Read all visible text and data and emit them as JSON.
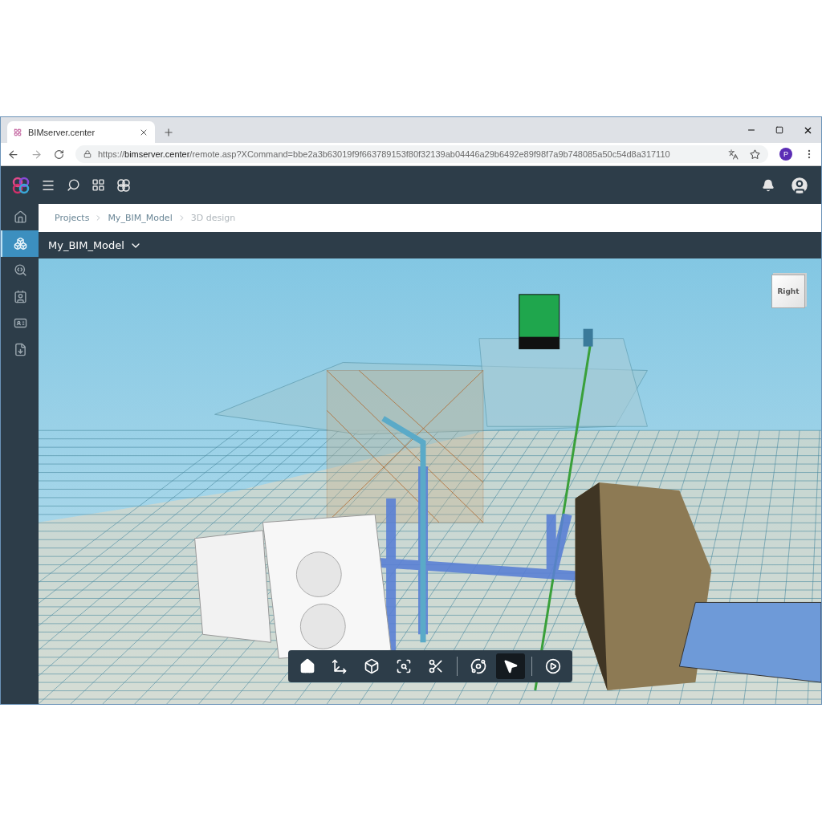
{
  "browser": {
    "tab_title": "BIMserver.center",
    "url": "https://**bimserver.center**/remote.asp?XCommand=bbe2a3b63019f9f663789153f80f32139ab04446a29b6492e89f98f7a9b748085a50c54d8a317110",
    "profile_initial": "P"
  },
  "sidebar": {
    "items": [
      {
        "kind": "home",
        "selected": false
      },
      {
        "kind": "model",
        "selected": true
      },
      {
        "kind": "inspect",
        "selected": false
      },
      {
        "kind": "contacts",
        "selected": false
      },
      {
        "kind": "certificate",
        "selected": false
      },
      {
        "kind": "download",
        "selected": false
      }
    ]
  },
  "breadcrumbs": [
    {
      "label": "Projects",
      "current": false
    },
    {
      "label": "My_BIM_Model",
      "current": false
    },
    {
      "label": "3D design",
      "current": true
    }
  ],
  "model_title": "My_BIM_Model",
  "view_cube": {
    "face": "Right"
  },
  "toolbar": {
    "groups": [
      {
        "tools": [
          {
            "kind": "home",
            "selected": false
          },
          {
            "kind": "axes",
            "selected": false
          },
          {
            "kind": "fit",
            "selected": false
          },
          {
            "kind": "zoom-window",
            "selected": false
          },
          {
            "kind": "section",
            "selected": false
          }
        ]
      },
      {
        "tools": [
          {
            "kind": "orbit",
            "selected": false
          },
          {
            "kind": "select",
            "selected": true
          }
        ]
      },
      {
        "tools": [
          {
            "kind": "play",
            "selected": false
          }
        ]
      }
    ]
  }
}
